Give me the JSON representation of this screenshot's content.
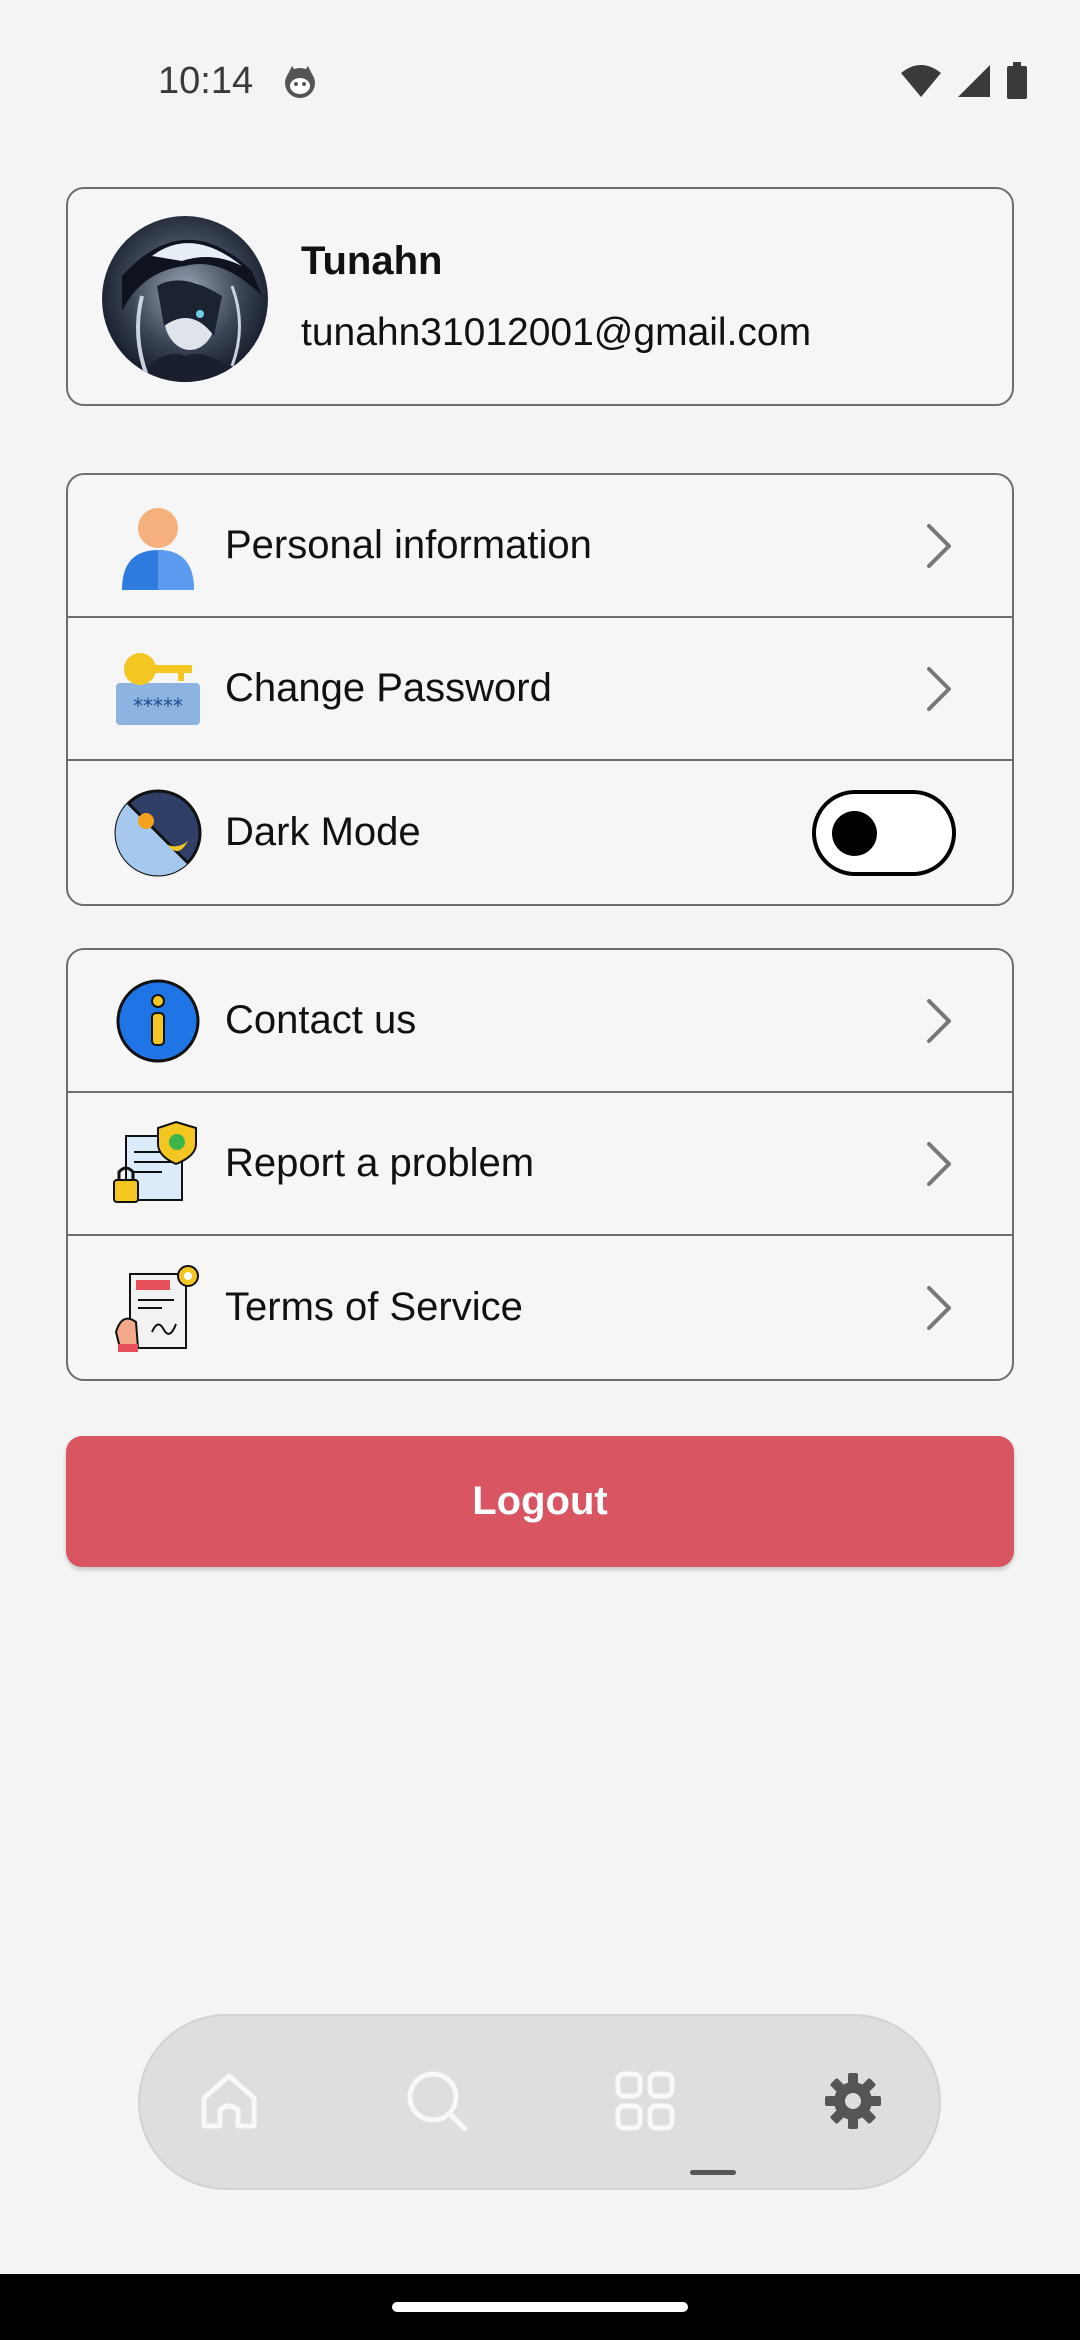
{
  "status_bar": {
    "time": "10:14",
    "icons": [
      "cat-face-icon",
      "wifi-icon",
      "signal-icon",
      "battery-icon"
    ]
  },
  "profile": {
    "name": "Tunahn",
    "email": "tunahn31012001@gmail.com"
  },
  "settings_group_1": [
    {
      "label": "Personal information",
      "icon": "person-icon",
      "control": "chevron"
    },
    {
      "label": "Change Password",
      "icon": "key-password-icon",
      "control": "chevron"
    },
    {
      "label": "Dark Mode",
      "icon": "day-night-icon",
      "control": "toggle",
      "toggle_on": false
    }
  ],
  "settings_group_2": [
    {
      "label": "Contact us",
      "icon": "info-icon",
      "control": "chevron"
    },
    {
      "label": "Report a problem",
      "icon": "report-shield-icon",
      "control": "chevron"
    },
    {
      "label": "Terms of Service",
      "icon": "contract-signature-icon",
      "control": "chevron"
    }
  ],
  "logout": {
    "label": "Logout"
  },
  "bottom_nav": {
    "items": [
      "home-icon",
      "search-icon",
      "apps-grid-icon",
      "settings-gear-icon"
    ],
    "active": "settings-gear-icon"
  },
  "colors": {
    "background": "#f4f4f4",
    "logout_button": "#d95562",
    "border": "#6d6d6d",
    "nav_background": "#dedede"
  }
}
